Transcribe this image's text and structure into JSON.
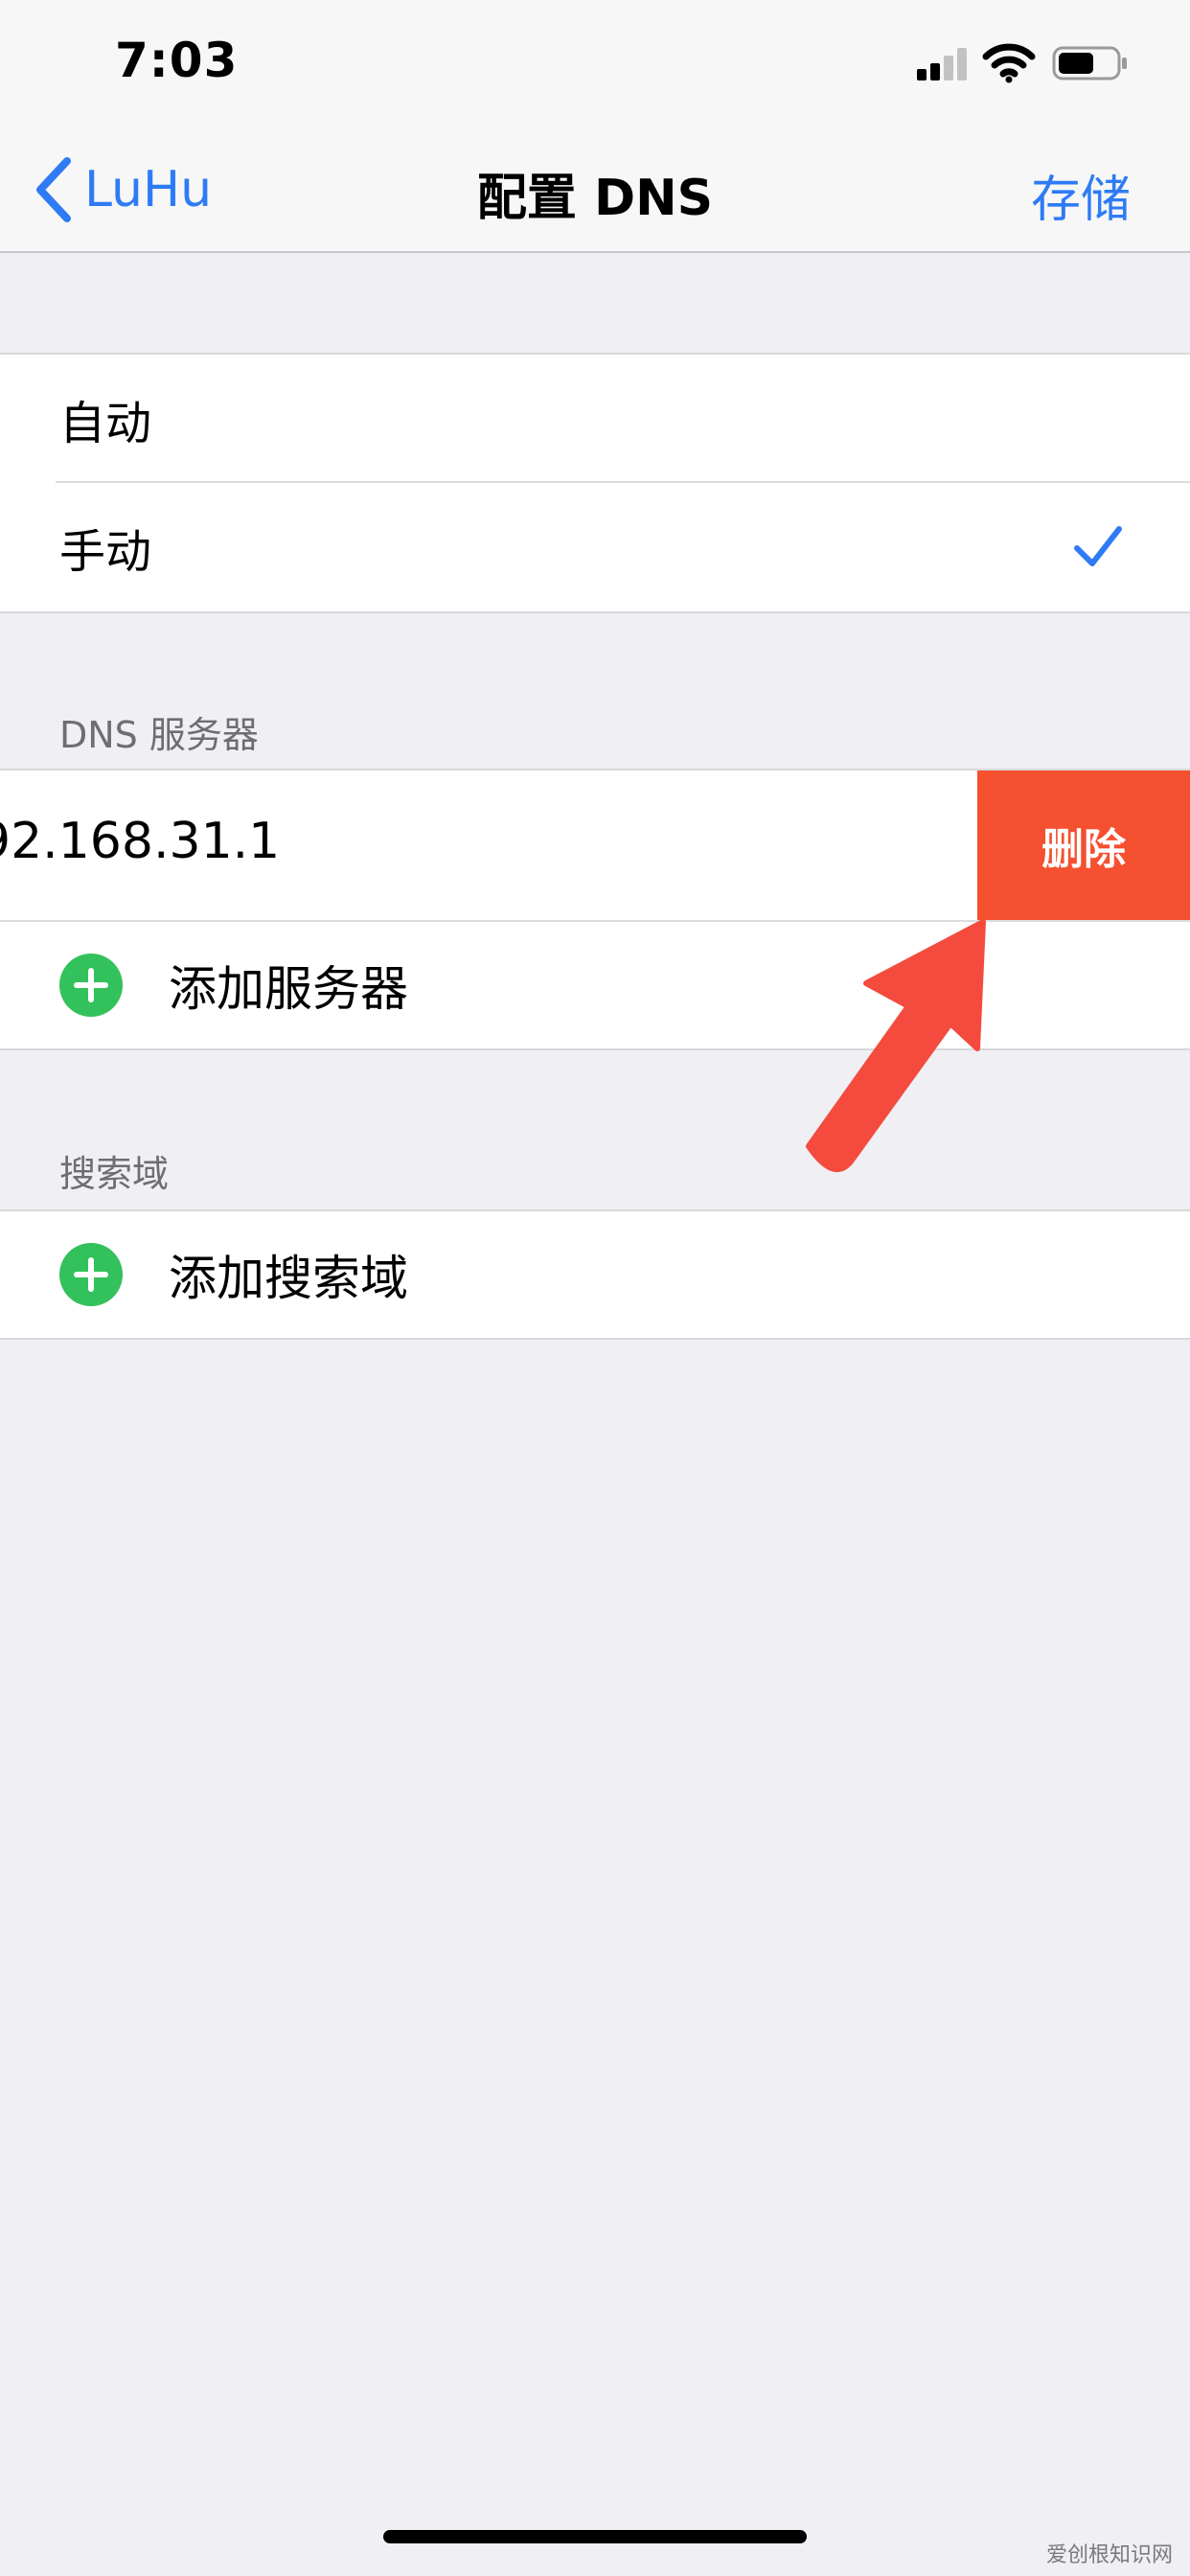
{
  "status_bar": {
    "time": "7:03",
    "icons": [
      "signal-icon",
      "wifi-icon",
      "battery-icon"
    ]
  },
  "nav": {
    "back_label": "LuHu",
    "back_icon": "chevron-left-icon",
    "title": "配置 DNS",
    "save_label": "存储"
  },
  "mode_group": {
    "options": [
      {
        "label": "自动",
        "selected": false
      },
      {
        "label": "手动",
        "selected": true
      }
    ],
    "selected_icon": "checkmark-icon"
  },
  "dns_section": {
    "header": "DNS 服务器",
    "server_value": "92.168.31.1",
    "delete_label": "删除",
    "add_label": "添加服务器"
  },
  "search_section": {
    "header": "搜索域",
    "add_label": "添加搜索域"
  },
  "watermark": "爱创根知识网",
  "colors": {
    "accent": "#2f7bf5",
    "delete": "#f5502f",
    "add": "#33c15b",
    "arrow": "#f44b3e",
    "background": "#efeff4"
  }
}
